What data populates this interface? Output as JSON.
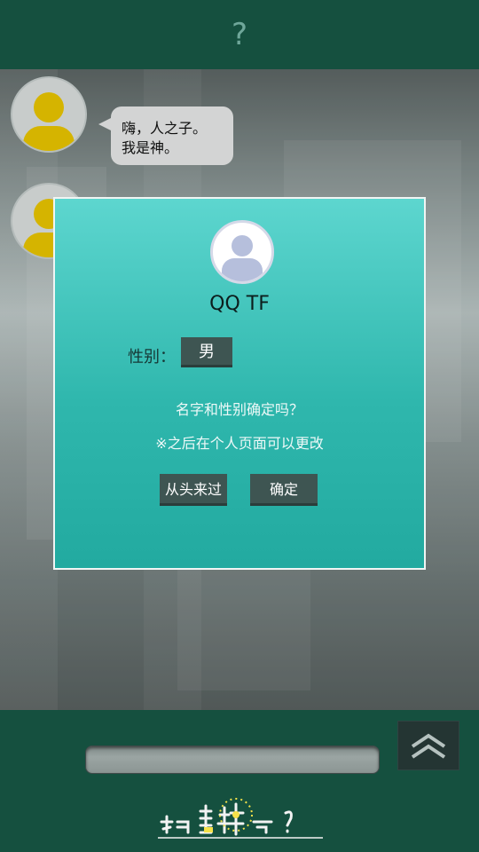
{
  "header": {
    "title": "?"
  },
  "chat": {
    "messages": [
      {
        "sender": "god",
        "text_line1": "嗨，人之子。",
        "text_line2": "我是神。"
      }
    ]
  },
  "dialog": {
    "username": "QQ TF",
    "gender_label": "性别：",
    "gender_value": "男",
    "question": "名字和性别确定吗？",
    "note": "※之后在个人页面可以更改",
    "restart_button": "从头来过",
    "confirm_button": "确定"
  },
  "bottom": {
    "input_value": "",
    "send_icon": "double-chevron-up-icon",
    "logo_text_main": "你相信神吗？"
  },
  "colors": {
    "bar": "#15503f",
    "dialog_top": "#5dd6cf",
    "dialog_bottom": "#22aaa0",
    "avatar_yellow": "#e8c400",
    "button": "#3e5552"
  }
}
